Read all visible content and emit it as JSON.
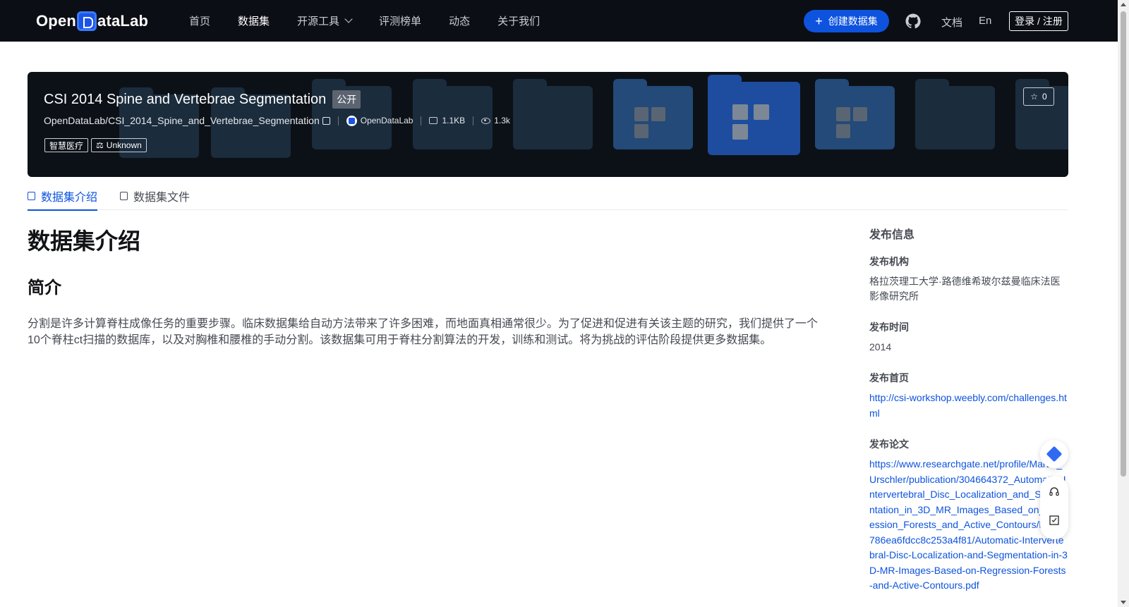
{
  "nav": {
    "logo": "OpenDataLab",
    "items": [
      {
        "label": "首页"
      },
      {
        "label": "数据集"
      },
      {
        "label": "开源工具"
      },
      {
        "label": "评测榜单"
      },
      {
        "label": "动态"
      },
      {
        "label": "关于我们"
      }
    ],
    "create_label": "创建数据集",
    "docs_label": "文档",
    "lang_label": "En",
    "login_label": "登录 / 注册"
  },
  "dataset": {
    "title": "CSI 2014 Spine and Vertebrae Segmentation",
    "visibility": "公开",
    "path": "OpenDataLab/CSI_2014_Spine_and_Vertebrae_Segmentation",
    "org": "OpenDataLab",
    "size": "1.1KB",
    "views": "1.3k",
    "tags": [
      "智慧医疗"
    ],
    "license": "Unknown",
    "stars": "0"
  },
  "tabs": [
    {
      "label": "数据集介绍"
    },
    {
      "label": "数据集文件"
    }
  ],
  "content": {
    "heading": "数据集介绍",
    "subheading": "简介",
    "paragraph": "分割是许多计算脊柱成像任务的重要步骤。临床数据集给自动方法带来了许多困难，而地面真相通常很少。为了促进和促进有关该主题的研究，我们提供了一个10个脊柱ct扫描的数据库，以及对胸椎和腰椎的手动分割。该数据集可用于脊柱分割算法的开发，训练和测试。将为挑战的评估阶段提供更多数据集。"
  },
  "sidebar": {
    "heading": "发布信息",
    "org_label": "发布机构",
    "org_value": "格拉茨理工大学·路德维希玻尔兹曼临床法医影像研究所",
    "time_label": "发布时间",
    "time_value": "2014",
    "home_label": "发布首页",
    "home_value": "http://csi-workshop.weebly.com/challenges.html",
    "paper_label": "发布论文",
    "paper_value": "https://www.researchgate.net/profile/Martin_Urschler/publication/304664372_Automatic_Intervertebral_Disc_Localization_and_Segmentation_in_3D_MR_Images_Based_on_Regression_Forests_and_Active_Contours/links/5786ea6fdcc8c253a4f81/Automatic-Intervertebral-Disc-Localization-and-Segmentation-in-3D-MR-Images-Based-on-Regression-Forests-and-Active-Contours.pdf"
  },
  "colors": {
    "nav_bg": "#0b0e14",
    "accent": "#0d53de",
    "banner_bg": "#0c1118"
  },
  "icons": {
    "github": "github-icon",
    "star": "star-icon",
    "copy": "copy-icon",
    "storage": "disk-icon",
    "views": "eye-icon",
    "license": "scale-icon",
    "support": "headset-icon",
    "feedback": "edit-icon"
  }
}
